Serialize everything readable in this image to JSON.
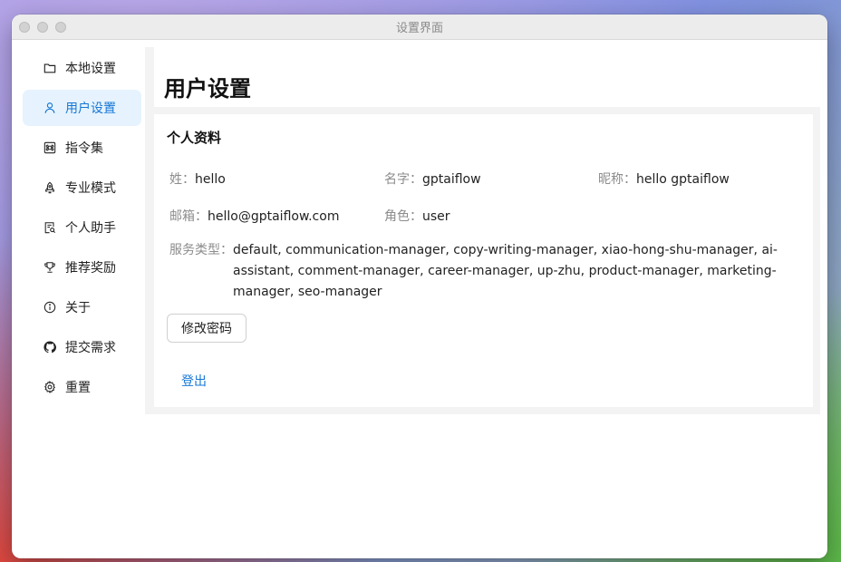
{
  "window": {
    "title": "设置界面"
  },
  "sidebar": {
    "items": [
      {
        "label": "本地设置",
        "icon": "folder-icon"
      },
      {
        "label": "用户设置",
        "icon": "user-icon",
        "active": true
      },
      {
        "label": "指令集",
        "icon": "command-icon"
      },
      {
        "label": "专业模式",
        "icon": "rocket-icon"
      },
      {
        "label": "个人助手",
        "icon": "assistant-doc-icon"
      },
      {
        "label": "推荐奖励",
        "icon": "trophy-icon"
      },
      {
        "label": "关于",
        "icon": "info-icon"
      },
      {
        "label": "提交需求",
        "icon": "github-icon"
      },
      {
        "label": "重置",
        "icon": "gear-icon"
      }
    ]
  },
  "main": {
    "title": "用户设置",
    "profile": {
      "title": "个人资料",
      "last_name": {
        "label": "姓：",
        "value": "hello"
      },
      "first_name": {
        "label": "名字：",
        "value": "gptaiflow"
      },
      "nickname": {
        "label": "昵称：",
        "value": "hello gptaiflow"
      },
      "email": {
        "label": "邮箱：",
        "value": "hello@gptaiflow.com"
      },
      "role": {
        "label": "角色：",
        "value": "user"
      },
      "service_type": {
        "label": "服务类型：",
        "value": "default, communication-manager, copy-writing-manager, xiao-hong-shu-manager, ai-assistant, comment-manager, career-manager, up-zhu, product-manager, marketing-manager, seo-manager"
      },
      "change_password": "修改密码",
      "logout": "登出"
    }
  },
  "colors": {
    "accent": "#1677d4",
    "active_bg": "#e6f3fe"
  }
}
